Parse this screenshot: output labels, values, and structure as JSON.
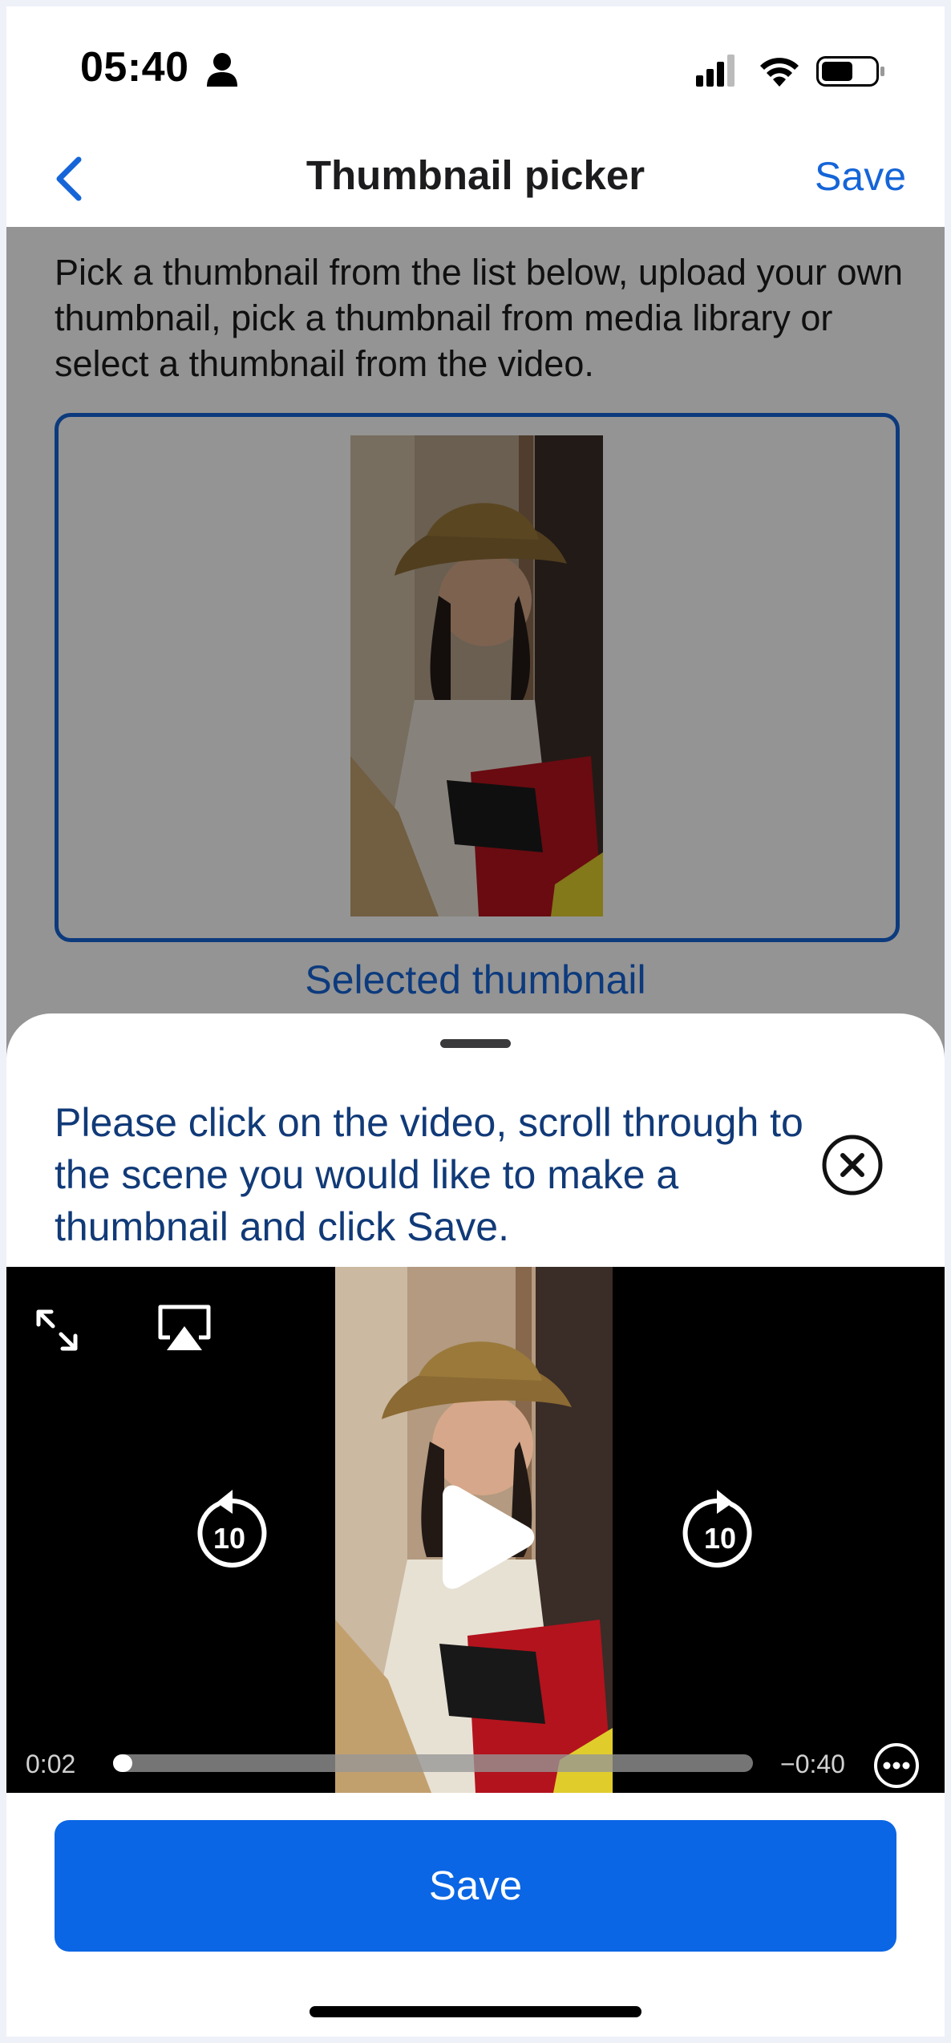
{
  "status_bar": {
    "time": "05:40",
    "person_icon": "person-icon",
    "signal_icon": "cellular-signal-icon",
    "wifi_icon": "wifi-icon",
    "battery_icon": "battery-icon"
  },
  "nav": {
    "back_icon": "chevron-left-icon",
    "title": "Thumbnail picker",
    "save_label": "Save"
  },
  "page": {
    "instructions": "Pick a thumbnail from the list below, upload your own thumbnail, pick a thumbnail from media library or select a thumbnail from the video.",
    "selected_label": "Selected thumbnail"
  },
  "sheet": {
    "message": "Please click on the video, scroll through to the scene you would like to make a thumbnail and click Save.",
    "close_icon": "close-circle-icon"
  },
  "video": {
    "current_time": "0:02",
    "remaining_time": "−0:40",
    "progress_fraction": 0.03,
    "skip_back_label": "10",
    "skip_forward_label": "10",
    "expand_icon": "expand-icon",
    "airplay_icon": "airplay-icon",
    "play_icon": "play-icon",
    "more_icon": "more-options-icon"
  },
  "footer": {
    "save_label": "Save"
  },
  "colors": {
    "accent": "#1565d8",
    "button": "#0a66e4",
    "message_text": "#113a78"
  }
}
